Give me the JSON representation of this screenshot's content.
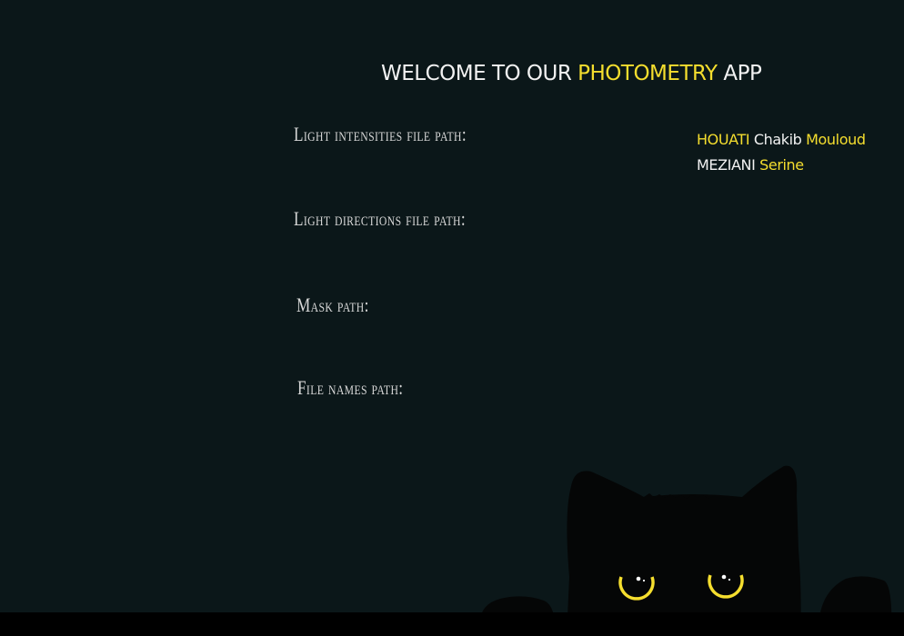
{
  "header": {
    "title_part1": "WELCOME TO OUR ",
    "title_highlight": "PHOTOMETRY",
    "title_part2": " APP"
  },
  "authors": {
    "line1": {
      "surname": "HOUATI",
      "first": "Chakib",
      "first2_initial": " M",
      "first2_rest": "ouloud"
    },
    "line2": {
      "surname": "MEZIANI",
      "first_initial": " S",
      "first_rest": "erine"
    }
  },
  "form": {
    "intensities_label": "Light intensities file path:",
    "directions_label": "Light directions file path:",
    "mask_label": "Mask path:",
    "filenames_label": "File names path:",
    "intensities_value": "",
    "directions_value": "",
    "mask_value": "",
    "filenames_value": ""
  },
  "colors": {
    "background": "#0b1719",
    "accent": "#f5de2e",
    "text": "#f2f2f2"
  },
  "decoration": {
    "image": "black-cat-peeking-icon"
  }
}
